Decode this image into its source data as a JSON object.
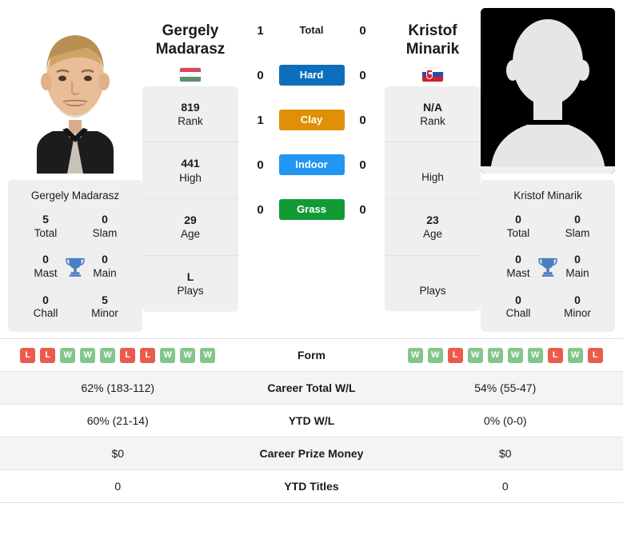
{
  "players": {
    "left": {
      "first_name": "Gergely",
      "last_name": "Madarasz",
      "full_name": "Gergely Madarasz",
      "country_flag": "hungary-flag",
      "photo": "player-headshot",
      "info": [
        {
          "value": "819",
          "label": "Rank"
        },
        {
          "value": "441",
          "label": "High"
        },
        {
          "value": "29",
          "label": "Age"
        },
        {
          "value": "L",
          "label": "Plays"
        }
      ],
      "titles": [
        {
          "value": "5",
          "label": "Total"
        },
        {
          "value": "0",
          "label": "Slam"
        },
        {
          "value": "0",
          "label": "Mast"
        },
        {
          "value": "0",
          "label": "Main"
        },
        {
          "value": "0",
          "label": "Chall"
        },
        {
          "value": "5",
          "label": "Minor"
        }
      ],
      "form": [
        "L",
        "L",
        "W",
        "W",
        "W",
        "L",
        "L",
        "W",
        "W",
        "W"
      ],
      "career_total_wl": "62% (183-112)",
      "ytd_wl": "60% (21-14)",
      "career_prize_money": "$0",
      "ytd_titles": "0"
    },
    "right": {
      "first_name": "Kristof",
      "last_name": "Minarik",
      "full_name": "Kristof Minarik",
      "country_flag": "slovakia-flag",
      "photo": "placeholder-silhouette",
      "info": [
        {
          "value": "N/A",
          "label": "Rank"
        },
        {
          "value": "",
          "label": "High"
        },
        {
          "value": "23",
          "label": "Age"
        },
        {
          "value": "",
          "label": "Plays"
        }
      ],
      "titles": [
        {
          "value": "0",
          "label": "Total"
        },
        {
          "value": "0",
          "label": "Slam"
        },
        {
          "value": "0",
          "label": "Mast"
        },
        {
          "value": "0",
          "label": "Main"
        },
        {
          "value": "0",
          "label": "Chall"
        },
        {
          "value": "0",
          "label": "Minor"
        }
      ],
      "form": [
        "W",
        "W",
        "L",
        "W",
        "W",
        "W",
        "W",
        "L",
        "W",
        "L"
      ],
      "career_total_wl": "54% (55-47)",
      "ytd_wl": "0% (0-0)",
      "career_prize_money": "$0",
      "ytd_titles": "0"
    }
  },
  "head_to_head": [
    {
      "label": "Total",
      "left": "1",
      "right": "0",
      "style": "plain",
      "color": ""
    },
    {
      "label": "Hard",
      "left": "0",
      "right": "0",
      "style": "pill",
      "color": "#0d6ebd"
    },
    {
      "label": "Clay",
      "left": "1",
      "right": "0",
      "style": "pill",
      "color": "#df9006"
    },
    {
      "label": "Indoor",
      "left": "0",
      "right": "0",
      "style": "pill",
      "color": "#2196f3"
    },
    {
      "label": "Grass",
      "left": "0",
      "right": "0",
      "style": "pill",
      "color": "#129a36"
    }
  ],
  "stats_rows": [
    {
      "label": "Form",
      "key": "form",
      "type": "form"
    },
    {
      "label": "Career Total W/L",
      "key": "career_total_wl",
      "type": "text"
    },
    {
      "label": "YTD W/L",
      "key": "ytd_wl",
      "type": "text"
    },
    {
      "label": "Career Prize Money",
      "key": "career_prize_money",
      "type": "text"
    },
    {
      "label": "YTD Titles",
      "key": "ytd_titles",
      "type": "text"
    }
  ],
  "colors": {
    "hard": "#0d6ebd",
    "clay": "#df9006",
    "indoor": "#2196f3",
    "grass": "#129a36",
    "win": "#83c68b",
    "loss": "#eb5b4b",
    "card_bg": "#efefef",
    "row_alt": "#f4f4f4"
  }
}
